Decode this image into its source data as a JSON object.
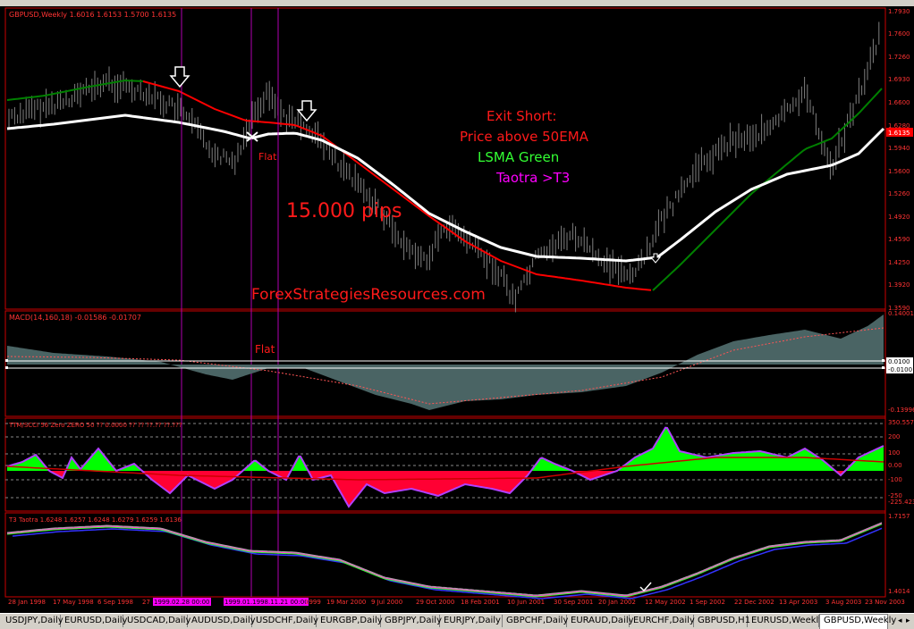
{
  "panels": {
    "main": {
      "label": "GBPUSD,Weekly 1.6016 1.6153 1.5700 1.6135",
      "price_label": "1.6135"
    },
    "macd": {
      "label": "MACD(14,160,18) -0.01586 -0.01707"
    },
    "cci": {
      "label": "TTM/SCCI 56 Zero ZERO 50 ?? 0.0000 ?? ?? ??.?? ??.???"
    },
    "t3": {
      "label": "T3 Taotra 1.6248 1.6257 1.6248 1.6279 1.6259 1.6136"
    }
  },
  "annotations": {
    "exit_short": "Exit Short:",
    "price_above": "Price above 50EMA",
    "lsma_green": "LSMA Green",
    "taotra": "Taotra >T3",
    "pips": "15.000 pips",
    "flat_main": "Flat",
    "flat_macd": "Flat",
    "website": "ForexStrategiesResources.com"
  },
  "price_axis": {
    "main": [
      "1.7930",
      "1.7600",
      "1.7260",
      "1.6930",
      "1.6600",
      "1.6280",
      "1.5940",
      "1.5600",
      "1.5260",
      "1.4920",
      "1.4590",
      "1.4250",
      "1.3920",
      "1.3590"
    ],
    "macd": [
      "0.14001",
      "0.0100",
      "-0.0100",
      "-0.13996"
    ],
    "cci": [
      "350.5574",
      "200",
      "100",
      "0.00",
      "-100",
      "-250",
      "-225.423"
    ],
    "t3": [
      "1.7157",
      "1.4014"
    ]
  },
  "date_axis": [
    "28 Jan 1998",
    "17 May 1998",
    "6 Sep 1998",
    "27",
    "1999.02.28 00:00",
    "1999.01.1998.11.21 00:00",
    "1999",
    "19 Mar 2000",
    "9 Jul 2000",
    "29 Oct 2000",
    "18 Feb 2001",
    "10 Jun 2001",
    "30 Sep 2001",
    "20 Jan 2002",
    "12 May 2002",
    "1 Sep 2002",
    "22 Dec 2002",
    "13 Apr 2003",
    "3 Aug 2003",
    "23 Nov 2003"
  ],
  "tabs": [
    "USDJPY,Daily",
    "EURUSD,Daily",
    "USDCAD,Daily",
    "AUDUSD,Daily",
    "USDCHF,Daily",
    "EURGBP,Daily",
    "GBPJPY,Daily",
    "EURJPY,Daily",
    "GBPCHF,Daily",
    "EURAUD,Daily",
    "EURCHF,Daily",
    "GBPUSD,H1",
    "EURUSD,Weekly",
    "GBPUSD,Weekly"
  ],
  "active_tab": "GBPUSD,Weekly",
  "colors": {
    "background": "#000000",
    "panel_border": "#cc0000",
    "ema": "#ffffff",
    "lsma_up": "#008000",
    "lsma_down": "#ff0000",
    "bars": "#7f7f7f",
    "vline": "#b000b0",
    "macd_hist": "#4a6464",
    "cci_pos": "#00ff00",
    "cci_neg": "#ff0033",
    "annotation_red": "#ff1a1a",
    "annotation_green": "#33ff33",
    "annotation_magenta": "#ff00ff"
  }
}
